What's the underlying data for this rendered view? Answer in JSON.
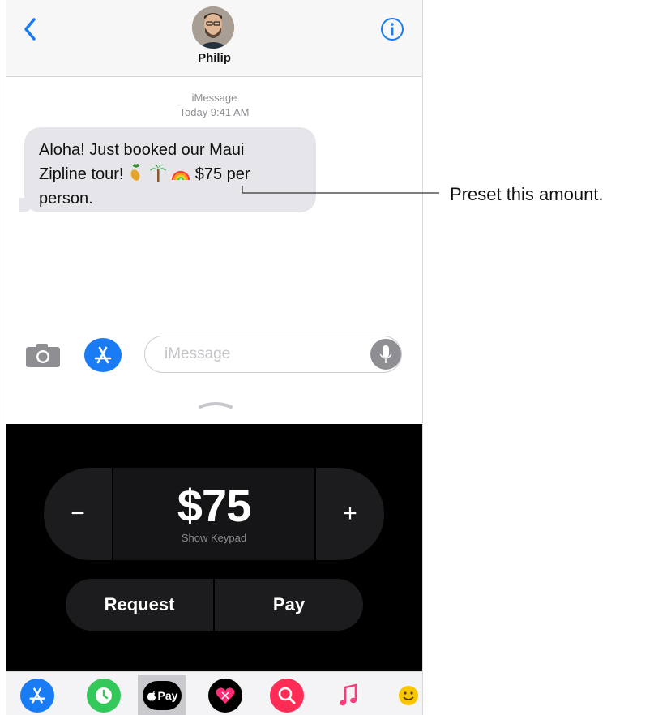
{
  "header": {
    "back_icon": "chevron-left-icon",
    "contact_name": "Philip",
    "info_icon": "info-icon"
  },
  "conversation": {
    "service": "iMessage",
    "timestamp": "Today 9:41 AM",
    "message_line1": "Aloha! Just booked our Maui",
    "message_line2_start": "Zipline tour!",
    "message_line2_end": "$75 per",
    "message_line3": "person.",
    "emoji": [
      "pineapple",
      "palm-tree",
      "rainbow"
    ]
  },
  "compose": {
    "camera_icon": "camera-icon",
    "appstore_icon": "app-store-icon",
    "placeholder": "iMessage",
    "mic_icon": "microphone-icon"
  },
  "pay_panel": {
    "minus_label": "−",
    "amount": "$75",
    "keypad_hint": "Show Keypad",
    "plus_label": "+",
    "request_label": "Request",
    "pay_label": "Pay"
  },
  "app_drawer": {
    "items": [
      {
        "name": "app-store",
        "icon": "app-store-icon",
        "color": "#1a7cf5"
      },
      {
        "name": "clock",
        "icon": "clock-icon",
        "color": "#34c759"
      },
      {
        "name": "apple-pay",
        "label": "Pay",
        "color": "#000000",
        "selected": true
      },
      {
        "name": "digital-touch",
        "icon": "heart-icon",
        "color": "#000000"
      },
      {
        "name": "search-images",
        "icon": "search-icon",
        "color": "#ff2d55"
      },
      {
        "name": "music",
        "icon": "music-note-icon",
        "color": "#fc3c7a"
      },
      {
        "name": "animoji",
        "icon": "smiley-icon",
        "color": "#f7c600"
      }
    ]
  },
  "callout": {
    "text": "Preset this amount."
  },
  "colors": {
    "accent": "#1a7cf5",
    "bubble": "#e5e5ea",
    "panel": "#000000"
  }
}
